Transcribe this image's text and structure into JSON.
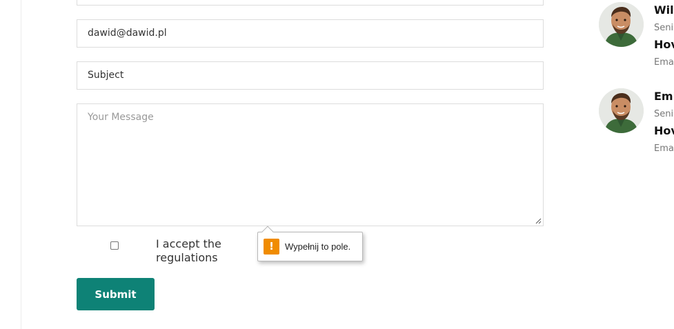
{
  "form": {
    "email_value": "dawid@dawid.pl",
    "subject_value": "Subject",
    "message_placeholder": "Your Message",
    "accept_label": "I accept the regulations",
    "submit_label": "Submit",
    "validation_tooltip": {
      "icon_glyph": "!",
      "text": "Wypełnij to pole."
    }
  },
  "sidebar": {
    "profiles": [
      {
        "name": "Wil",
        "role": "Seni",
        "headline": "Hov",
        "email": "Ema"
      },
      {
        "name": "Emi",
        "role": "Seni",
        "headline": "Hov",
        "email": "Ema"
      }
    ]
  },
  "colors": {
    "accent": "#0e8276",
    "warning": "#f08c00",
    "border": "#dcdcdc"
  }
}
